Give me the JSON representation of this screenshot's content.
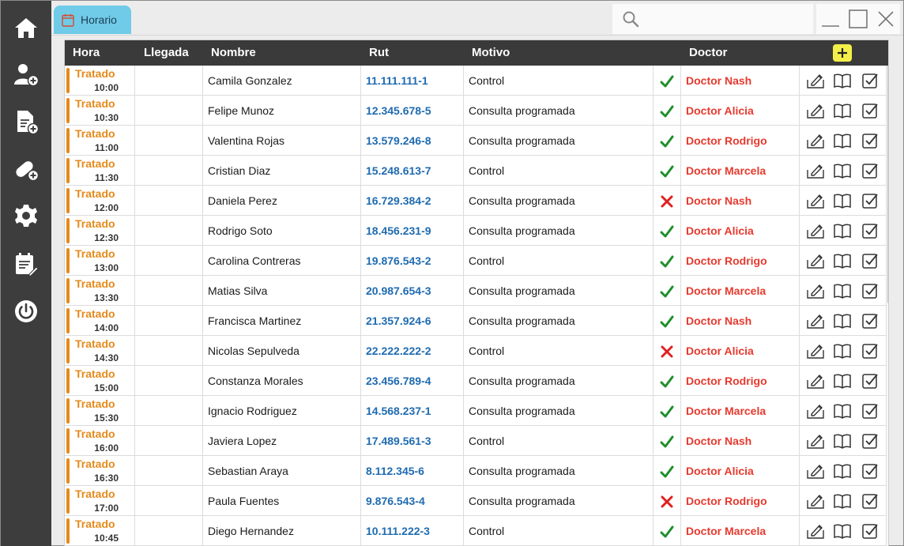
{
  "sidebar": {
    "items": [
      {
        "name": "home-icon"
      },
      {
        "name": "add-user-icon"
      },
      {
        "name": "add-document-icon"
      },
      {
        "name": "add-medicine-icon"
      },
      {
        "name": "gear-icon"
      },
      {
        "name": "schedule-edit-icon"
      },
      {
        "name": "power-icon"
      }
    ]
  },
  "tab": {
    "label": "Horario",
    "icon": "calendar-icon",
    "color": "#6fcbe8"
  },
  "search": {
    "placeholder": "",
    "value": ""
  },
  "window_controls": [
    "minimize-icon",
    "maximize-icon",
    "close-icon"
  ],
  "table": {
    "headers": {
      "hora": "Hora",
      "llegada": "Llegada",
      "nombre": "Nombre",
      "rut": "Rut",
      "motivo": "Motivo",
      "doctor": "Doctor"
    },
    "add_icon": "plus-icon",
    "colors": {
      "status": "#e58a1b",
      "rut": "#1f6bb0",
      "doctor": "#e63a2e",
      "check": "#1e8f2b",
      "cross": "#e02020",
      "add": "#f4f04a"
    },
    "rows": [
      {
        "status": "Tratado",
        "time": "10:00",
        "llegada": "",
        "nombre": "Camila Gonzalez",
        "rut": "11.111.111-1",
        "motivo": "Control",
        "mark": "check",
        "doctor": "Doctor Nash"
      },
      {
        "status": "Tratado",
        "time": "10:30",
        "llegada": "",
        "nombre": "Felipe Munoz",
        "rut": "12.345.678-5",
        "motivo": "Consulta programada",
        "mark": "check",
        "doctor": "Doctor Alicia"
      },
      {
        "status": "Tratado",
        "time": "11:00",
        "llegada": "",
        "nombre": "Valentina Rojas",
        "rut": "13.579.246-8",
        "motivo": "Consulta programada",
        "mark": "check",
        "doctor": "Doctor Rodrigo"
      },
      {
        "status": "Tratado",
        "time": "11:30",
        "llegada": "",
        "nombre": "Cristian Diaz",
        "rut": "15.248.613-7",
        "motivo": "Control",
        "mark": "check",
        "doctor": "Doctor Marcela"
      },
      {
        "status": "Tratado",
        "time": "12:00",
        "llegada": "",
        "nombre": "Daniela Perez",
        "rut": "16.729.384-2",
        "motivo": "Consulta programada",
        "mark": "cross",
        "doctor": "Doctor Nash"
      },
      {
        "status": "Tratado",
        "time": "12:30",
        "llegada": "",
        "nombre": "Rodrigo Soto",
        "rut": "18.456.231-9",
        "motivo": "Consulta programada",
        "mark": "check",
        "doctor": "Doctor Alicia"
      },
      {
        "status": "Tratado",
        "time": "13:00",
        "llegada": "",
        "nombre": "Carolina Contreras",
        "rut": "19.876.543-2",
        "motivo": "Control",
        "mark": "check",
        "doctor": "Doctor Rodrigo"
      },
      {
        "status": "Tratado",
        "time": "13:30",
        "llegada": "",
        "nombre": "Matias Silva",
        "rut": "20.987.654-3",
        "motivo": "Consulta programada",
        "mark": "check",
        "doctor": "Doctor Marcela"
      },
      {
        "status": "Tratado",
        "time": "14:00",
        "llegada": "",
        "nombre": "Francisca Martinez",
        "rut": "21.357.924-6",
        "motivo": "Consulta programada",
        "mark": "check",
        "doctor": "Doctor Nash"
      },
      {
        "status": "Tratado",
        "time": "14:30",
        "llegada": "",
        "nombre": "Nicolas Sepulveda",
        "rut": "22.222.222-2",
        "motivo": "Control",
        "mark": "cross",
        "doctor": "Doctor Alicia"
      },
      {
        "status": "Tratado",
        "time": "15:00",
        "llegada": "",
        "nombre": "Constanza Morales",
        "rut": "23.456.789-4",
        "motivo": "Consulta programada",
        "mark": "check",
        "doctor": "Doctor Rodrigo"
      },
      {
        "status": "Tratado",
        "time": "15:30",
        "llegada": "",
        "nombre": "Ignacio Rodriguez",
        "rut": "14.568.237-1",
        "motivo": "Consulta programada",
        "mark": "check",
        "doctor": "Doctor Marcela"
      },
      {
        "status": "Tratado",
        "time": "16:00",
        "llegada": "",
        "nombre": "Javiera Lopez",
        "rut": "17.489.561-3",
        "motivo": "Control",
        "mark": "check",
        "doctor": "Doctor Nash"
      },
      {
        "status": "Tratado",
        "time": "16:30",
        "llegada": "",
        "nombre": "Sebastian Araya",
        "rut": "8.112.345-6",
        "motivo": "Consulta programada",
        "mark": "check",
        "doctor": "Doctor Alicia"
      },
      {
        "status": "Tratado",
        "time": "17:00",
        "llegada": "",
        "nombre": "Paula Fuentes",
        "rut": "9.876.543-4",
        "motivo": "Consulta programada",
        "mark": "cross",
        "doctor": "Doctor Rodrigo"
      },
      {
        "status": "Tratado",
        "time": "10:45",
        "llegada": "",
        "nombre": "Diego Hernandez",
        "rut": "10.111.222-3",
        "motivo": "Control",
        "mark": "check",
        "doctor": "Doctor Marcela"
      }
    ],
    "row_actions": [
      "edit-icon",
      "book-icon",
      "checkbox-icon"
    ]
  }
}
